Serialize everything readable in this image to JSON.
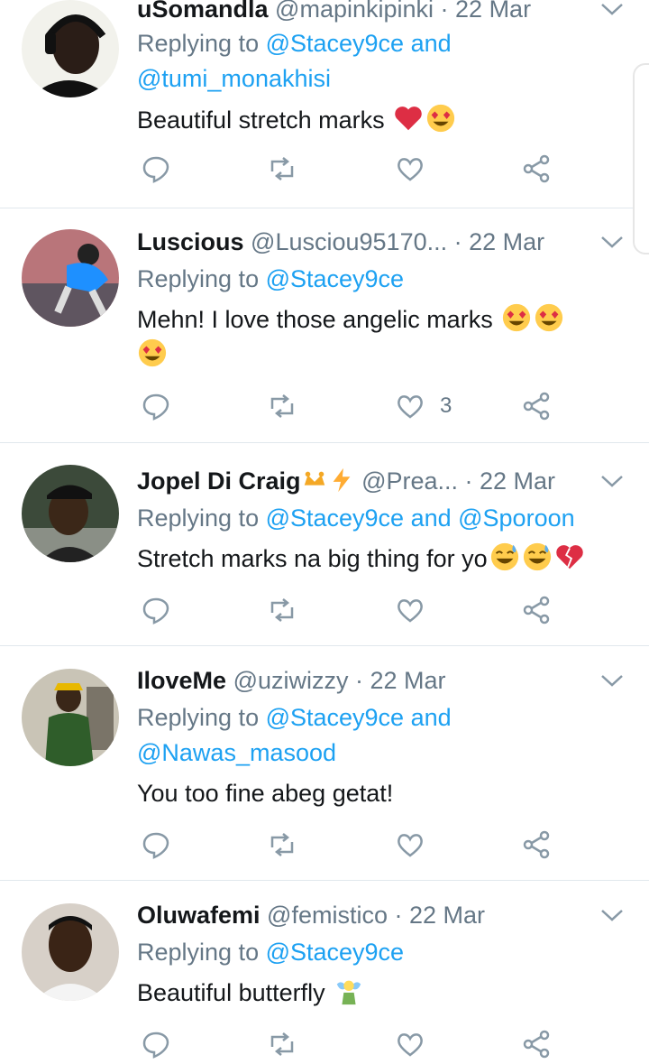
{
  "colors": {
    "link": "#1da1f2",
    "muted": "#657786",
    "text": "#14171a",
    "heart": "#e0245e"
  },
  "tweets": [
    {
      "name": "uSomandla",
      "handle": "@mapinkipinki",
      "sep": " · ",
      "date": "22 Mar",
      "replying_prefix": "Replying to ",
      "mentions_line1": "@Stacey9ce and",
      "mentions_line2": "@tumi_monakhisi",
      "text": "Beautiful stretch marks",
      "emojis": [
        "red-heart",
        "heart-eyes"
      ],
      "like_count": ""
    },
    {
      "name": "Luscious",
      "handle": "@Lusciou95170...",
      "sep": " · ",
      "date": "22 Mar",
      "replying_prefix": "Replying to ",
      "mentions_line1": "@Stacey9ce",
      "mentions_line2": "",
      "text": "Mehn!  I love those angelic marks",
      "emojis": [
        "heart-eyes",
        "heart-eyes",
        "heart-eyes"
      ],
      "like_count": "3"
    },
    {
      "name": "Jopel Di Craig",
      "handle": "@Prea...",
      "sep": " · ",
      "date": "22 Mar",
      "replying_prefix": "Replying to ",
      "mentions_line1": "@Stacey9ce and @Sporoon",
      "mentions_line2": "",
      "text": "Stretch marks na big thing for yo",
      "emojis": [
        "sweat-smile",
        "sweat-smile",
        "broken-heart"
      ],
      "like_count": ""
    },
    {
      "name": "IloveMe",
      "handle": "@uziwizzy",
      "sep": " · ",
      "date": "22 Mar",
      "replying_prefix": "Replying to ",
      "mentions_line1": "@Stacey9ce and",
      "mentions_line2": "@Nawas_masood",
      "text": "You too fine abeg getat!",
      "emojis": [],
      "like_count": ""
    },
    {
      "name": "Oluwafemi",
      "handle": "@femistico",
      "sep": " · ",
      "date": "22 Mar",
      "replying_prefix": "Replying to ",
      "mentions_line1": "@Stacey9ce",
      "mentions_line2": "",
      "text": "Beautiful butterfly",
      "emojis": [
        "fairy"
      ],
      "like_count": ""
    }
  ]
}
